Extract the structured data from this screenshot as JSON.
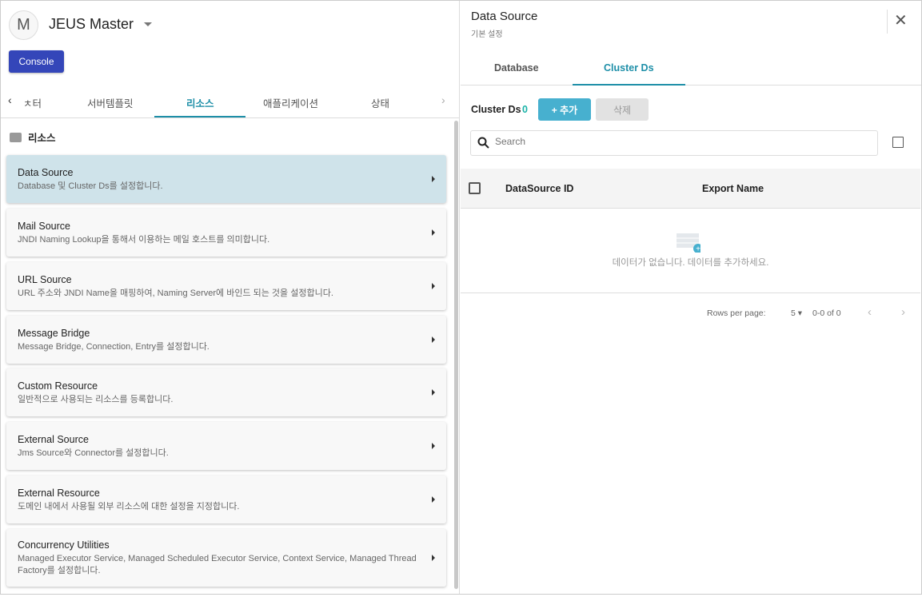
{
  "header": {
    "avatar_letter": "M",
    "title": "JEUS Master",
    "console_label": "Console"
  },
  "tabs": [
    {
      "label": "ㅊ터"
    },
    {
      "label": "서버템플릿"
    },
    {
      "label": "리소스",
      "active": true
    },
    {
      "label": "애플리케이션"
    },
    {
      "label": "상태"
    }
  ],
  "section_title": "리소스",
  "items": [
    {
      "name": "Data Source",
      "desc": "Database 및 Cluster Ds를 설정합니다.",
      "selected": true
    },
    {
      "name": "Mail Source",
      "desc": "JNDI Naming Lookup을 통해서 이용하는 메일 호스트를 의미합니다."
    },
    {
      "name": "URL Source",
      "desc": "URL 주소와 JNDI Name을 매핑하여, Naming Server에 바인드 되는 것을 설정합니다."
    },
    {
      "name": "Message Bridge",
      "desc": "Message Bridge, Connection, Entry를 설정합니다."
    },
    {
      "name": "Custom Resource",
      "desc": "일반적으로 사용되는 리소스를 등록합니다."
    },
    {
      "name": "External Source",
      "desc": "Jms Source와 Connector를 설정합니다."
    },
    {
      "name": "External Resource",
      "desc": "도메인 내에서 사용될 외부 리소스에 대한 설정을 지정합니다."
    },
    {
      "name": "Concurrency Utilities",
      "desc": "Managed Executor Service, Managed Scheduled Executor Service, Context Service, Managed Thread Factory를 설정합니다."
    }
  ],
  "right": {
    "title": "Data Source",
    "subtitle": "기본 설정",
    "tabs": [
      {
        "label": "Database"
      },
      {
        "label": "Cluster Ds",
        "active": true
      }
    ],
    "list_label": "Cluster Ds",
    "count": "0",
    "add_label": "+ 추가",
    "delete_label": "삭제",
    "search_placeholder": "Search",
    "columns": [
      "DataSource ID",
      "Export Name"
    ],
    "empty_text": "데이터가 없습니다. 데이터를 추가하세요.",
    "pagination": {
      "rows_label": "Rows per page:",
      "rows_value": "5",
      "range": "0-0 of 0"
    }
  },
  "colors": {
    "primary": "#3446b9",
    "accent": "#1e8fa8",
    "add": "#47b0cf",
    "selected": "#cfe3ea"
  }
}
